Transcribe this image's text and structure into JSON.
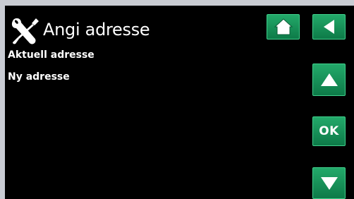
{
  "header": {
    "title": "Angi adresse",
    "title_icon": "tools-icon"
  },
  "rows": [
    {
      "label": "Aktuell adresse"
    },
    {
      "label": "Ny adresse"
    }
  ],
  "buttons": {
    "home_icon": "home-icon",
    "back_icon": "back-arrow-icon",
    "up_icon": "up-arrow-icon",
    "ok_label": "OK",
    "down_icon": "down-arrow-icon"
  },
  "colors": {
    "background": "#000000",
    "button_green": "#1a9a5c",
    "text": "#ffffff",
    "bezel": "#c9ccd3"
  }
}
